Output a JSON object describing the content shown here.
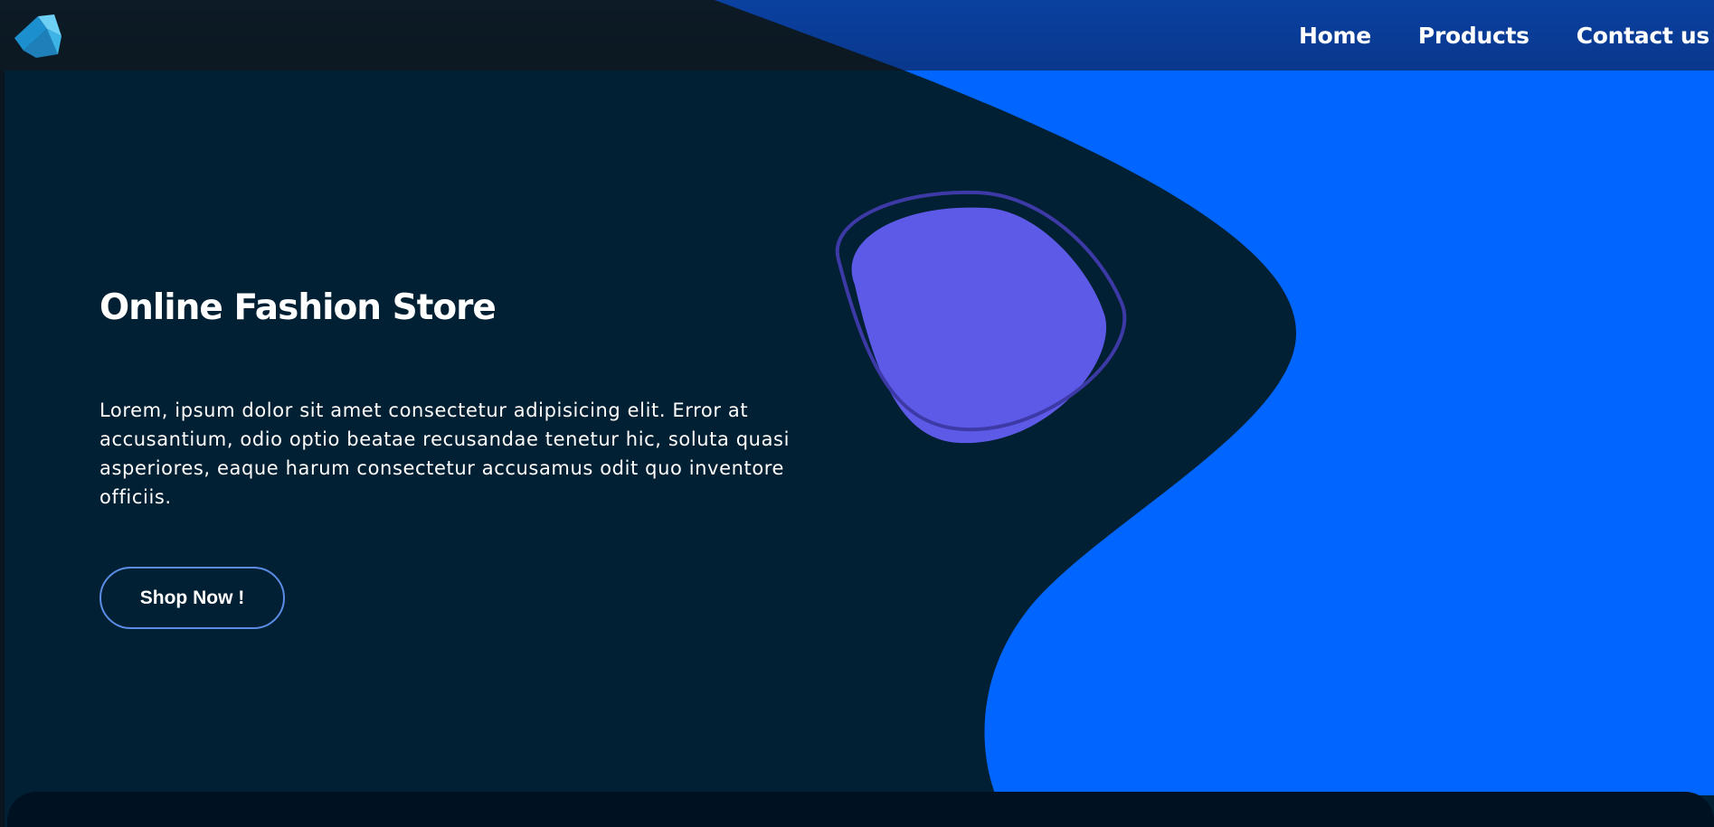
{
  "nav": {
    "logo_icon": "cube-logo-icon",
    "links": [
      {
        "label": "Home"
      },
      {
        "label": "Products"
      },
      {
        "label": "Contact us"
      }
    ]
  },
  "hero": {
    "title": "Online Fashion Store",
    "description": "Lorem, ipsum dolor sit amet consectetur adipisicing elit. Error at accusantium, odio optio beatae recusandae tenetur hic, soluta quasi asperiores, eaque harum consectetur accusamus odit quo inventore officiis.",
    "cta_label": "Shop Now !"
  },
  "colors": {
    "background_dark": "#022033",
    "accent_blue": "#0066ff",
    "blob_purple": "#5e5ae8",
    "button_border": "#5b8de6",
    "footer_dark": "#001221"
  }
}
